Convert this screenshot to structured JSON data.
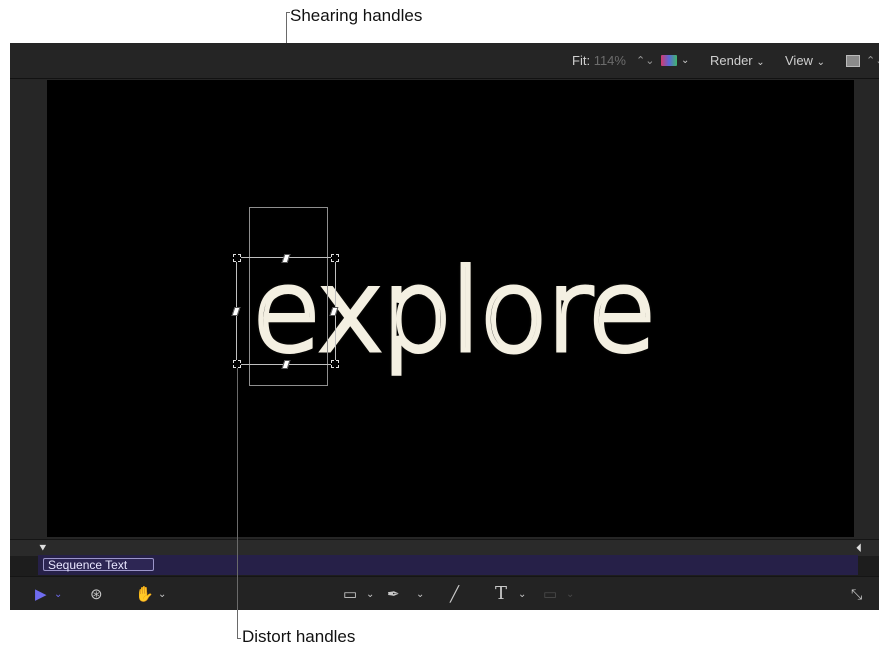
{
  "callouts": {
    "top": "Shearing handles",
    "bottom": "Distort handles"
  },
  "viewer_toolbar": {
    "fit_label": "Fit:",
    "fit_value": "114%",
    "render_label": "Render",
    "view_label": "View"
  },
  "canvas": {
    "text": "explore"
  },
  "timeline": {
    "layer_name": "Sequence Text"
  },
  "icons": {
    "fit_stepper": "⌃⌄",
    "chevron": "⌄",
    "select": "▶",
    "orbit": "⊛",
    "hand": "✋",
    "shape": "▭",
    "pen": "✒",
    "brush": "╱",
    "text": "T",
    "mask": "▭",
    "fullscreen": "⤡",
    "playhead_start": "⯆",
    "playhead_end": "⏴"
  },
  "colors": {
    "select_accent": "#6f6cf0",
    "layer_track": "#262048",
    "text_stroke": "#f4f0e2"
  }
}
